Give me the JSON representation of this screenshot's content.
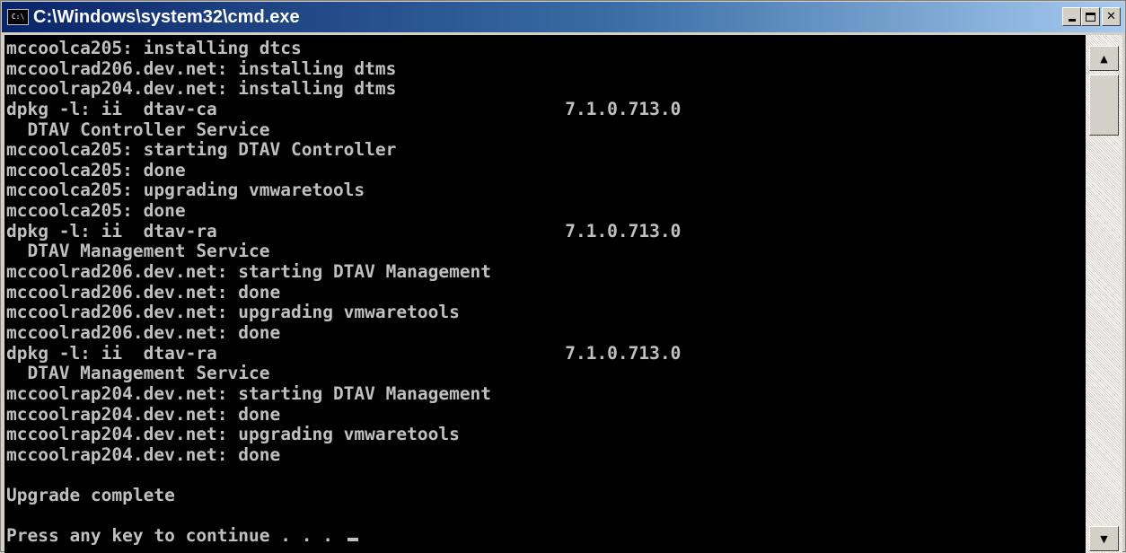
{
  "window": {
    "title": "C:\\Windows\\system32\\cmd.exe",
    "icon_label": "C:\\",
    "icon": "console-icon"
  },
  "caption_buttons": {
    "minimize_icon": "minimize-icon",
    "maximize_icon": "maximize-icon",
    "close_icon": "close-icon",
    "close_glyph": "✕"
  },
  "console": {
    "lines": [
      "mccoolca205: installing dtcs",
      "mccoolrad206.dev.net: installing dtms",
      "mccoolrap204.dev.net: installing dtms",
      "dpkg -l: ii  dtav-ca                                 7.1.0.713.0",
      "  DTAV Controller Service",
      "mccoolca205: starting DTAV Controller",
      "mccoolca205: done",
      "mccoolca205: upgrading vmwaretools",
      "mccoolca205: done",
      "dpkg -l: ii  dtav-ra                                 7.1.0.713.0",
      "  DTAV Management Service",
      "mccoolrad206.dev.net: starting DTAV Management",
      "mccoolrad206.dev.net: done",
      "mccoolrad206.dev.net: upgrading vmwaretools",
      "mccoolrad206.dev.net: done",
      "dpkg -l: ii  dtav-ra                                 7.1.0.713.0",
      "  DTAV Management Service",
      "mccoolrap204.dev.net: starting DTAV Management",
      "mccoolrap204.dev.net: done",
      "mccoolrap204.dev.net: upgrading vmwaretools",
      "mccoolrap204.dev.net: done",
      "",
      "Upgrade complete",
      "",
      "Press any key to continue . . . "
    ],
    "text_color": "#c0c0c0",
    "background_color": "#000000"
  },
  "scrollbar": {
    "up_arrow": "▲",
    "down_arrow": "▼",
    "up_icon": "scroll-up-arrow-icon",
    "down_icon": "scroll-down-arrow-icon"
  }
}
